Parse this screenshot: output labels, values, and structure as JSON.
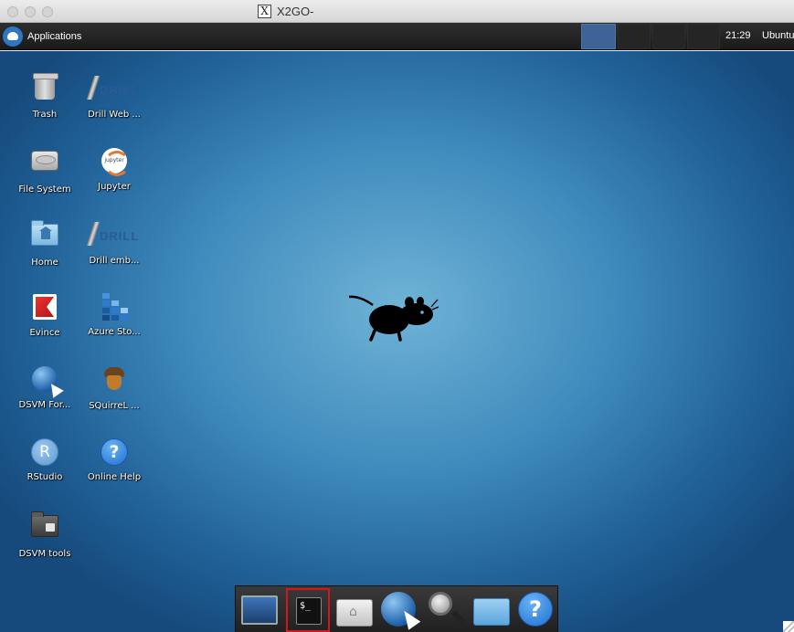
{
  "window": {
    "title": "X2GO-",
    "title_icon": "x-window-icon"
  },
  "panel": {
    "applications_label": "Applications",
    "menu_icon": "xfce-mouse-logo",
    "workspaces": [
      "workspace-1",
      "workspace-2",
      "workspace-3",
      "workspace-4"
    ],
    "active_workspace": 1,
    "clock": "21:29",
    "user": "Ubuntu"
  },
  "desktop": {
    "icons": [
      {
        "label": "Trash",
        "icon": "trash-icon"
      },
      {
        "label": "Drill Web ...",
        "icon": "drill-icon"
      },
      {
        "label": "File System",
        "icon": "hard-drive-icon"
      },
      {
        "label": "Jupyter",
        "icon": "jupyter-icon"
      },
      {
        "label": "Home",
        "icon": "home-folder-icon"
      },
      {
        "label": "Drill emb...",
        "icon": "drill-icon"
      },
      {
        "label": "Evince",
        "icon": "evince-icon"
      },
      {
        "label": "Azure Sto...",
        "icon": "azure-storage-icon"
      },
      {
        "label": "DSVM For...",
        "icon": "web-browser-icon"
      },
      {
        "label": "SQuirreL ...",
        "icon": "squirrel-acorn-icon"
      },
      {
        "label": "RStudio",
        "icon": "rstudio-icon"
      },
      {
        "label": "Online Help",
        "icon": "help-icon"
      },
      {
        "label": "DSVM tools",
        "icon": "locked-folder-icon"
      }
    ],
    "drill_logo_text": "DRILL",
    "jupyter_logo_text": "jupyter",
    "rstudio_glyph": "R",
    "help_glyph": "?",
    "wallpaper_icon": "xfce-mouse-icon"
  },
  "dock": {
    "items": [
      {
        "name": "show-desktop",
        "icon": "desktop-screen-icon"
      },
      {
        "name": "terminal",
        "icon": "terminal-icon",
        "glyph": "$_",
        "highlighted": true
      },
      {
        "name": "home-folder",
        "icon": "home-folder-icon"
      },
      {
        "name": "web-browser",
        "icon": "web-browser-icon"
      },
      {
        "name": "app-finder",
        "icon": "magnifier-icon"
      },
      {
        "name": "file-manager",
        "icon": "folder-icon"
      },
      {
        "name": "help",
        "icon": "help-icon",
        "glyph": "?"
      }
    ],
    "highlight_color": "#d7161b"
  },
  "colors": {
    "panel_bg": "#1f1f1f",
    "active_workspace": "#3d6494",
    "desktop_center": "#6fb3d6",
    "desktop_edge": "#164a7c"
  }
}
